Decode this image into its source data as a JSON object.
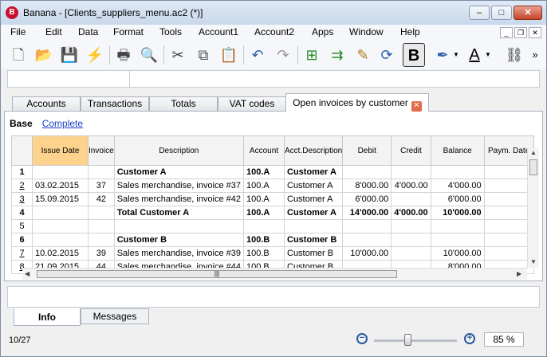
{
  "window": {
    "title": "Banana - [Clients_suppliers_menu.ac2 (*)]",
    "app_letter": "B"
  },
  "menu": [
    "File",
    "Edit",
    "Data",
    "Format",
    "Tools",
    "Account1",
    "Account2",
    "Apps",
    "Window",
    "Help"
  ],
  "toolbar": {
    "icons": [
      "new-document-icon",
      "open-folder-icon",
      "save-icon",
      "pdf-icon",
      "print-icon",
      "print-preview-icon",
      "cut-icon",
      "copy-icon",
      "paste-icon",
      "undo-icon",
      "redo-icon",
      "add-row-icon",
      "insert-row-icon",
      "edit-icon",
      "recalculate-icon",
      "bold-icon",
      "highlight-icon",
      "font-color-icon",
      "binoculars-icon",
      "more-icon"
    ],
    "bold_label": "B",
    "font_color_label": "A"
  },
  "tabs": [
    "Accounts",
    "Transactions",
    "Totals",
    "VAT codes",
    "Open invoices by customer"
  ],
  "views": {
    "base": "Base",
    "complete": "Complete"
  },
  "columns": [
    "Issue Date",
    "Invoice",
    "Description",
    "Account",
    "Acct.Description",
    "Debit",
    "Credit",
    "Balance",
    "Paym. Date"
  ],
  "rows": [
    {
      "n": "1",
      "date": "",
      "inv": "",
      "desc": "Customer A",
      "acct": "100.A",
      "acctdesc": "Customer A",
      "debit": "",
      "credit": "",
      "balance": "",
      "paym": "",
      "bold": true,
      "ul": false
    },
    {
      "n": "2",
      "date": "03.02.2015",
      "inv": "37",
      "desc": "Sales merchandise, invoice #37",
      "acct": "100.A",
      "acctdesc": "Customer A",
      "debit": "8'000.00",
      "credit": "4'000.00",
      "balance": "4'000.00",
      "paym": "",
      "bold": false,
      "ul": true
    },
    {
      "n": "3",
      "date": "15.09.2015",
      "inv": "42",
      "desc": "Sales merchandise, invoice #42",
      "acct": "100.A",
      "acctdesc": "Customer A",
      "debit": "6'000.00",
      "credit": "",
      "balance": "6'000.00",
      "paym": "",
      "bold": false,
      "ul": true
    },
    {
      "n": "4",
      "date": "",
      "inv": "",
      "desc": "Total Customer A",
      "acct": "100.A",
      "acctdesc": "Customer A",
      "debit": "14'000.00",
      "credit": "4'000.00",
      "balance": "10'000.00",
      "paym": "",
      "bold": true,
      "ul": false
    },
    {
      "n": "5",
      "date": "",
      "inv": "",
      "desc": "",
      "acct": "",
      "acctdesc": "",
      "debit": "",
      "credit": "",
      "balance": "",
      "paym": "",
      "bold": false,
      "ul": false
    },
    {
      "n": "6",
      "date": "",
      "inv": "",
      "desc": "Customer B",
      "acct": "100.B",
      "acctdesc": "Customer B",
      "debit": "",
      "credit": "",
      "balance": "",
      "paym": "",
      "bold": true,
      "ul": false
    },
    {
      "n": "7",
      "date": "10.02.2015",
      "inv": "39",
      "desc": "Sales merchandise, invoice #39",
      "acct": "100.B",
      "acctdesc": "Customer B",
      "debit": "10'000.00",
      "credit": "",
      "balance": "10'000.00",
      "paym": "",
      "bold": false,
      "ul": true
    },
    {
      "n": "8",
      "date": "21.09.2015",
      "inv": "44",
      "desc": "Sales merchandise, invoice #44",
      "acct": "100.B",
      "acctdesc": "Customer B",
      "debit": "",
      "credit": "",
      "balance": "8'000.00",
      "paym": "",
      "bold": false,
      "ul": true
    }
  ],
  "bottom_tabs": [
    "Info",
    "Messages"
  ],
  "status": {
    "position": "10/27",
    "zoom": "85 %",
    "zoom_level": 85
  }
}
